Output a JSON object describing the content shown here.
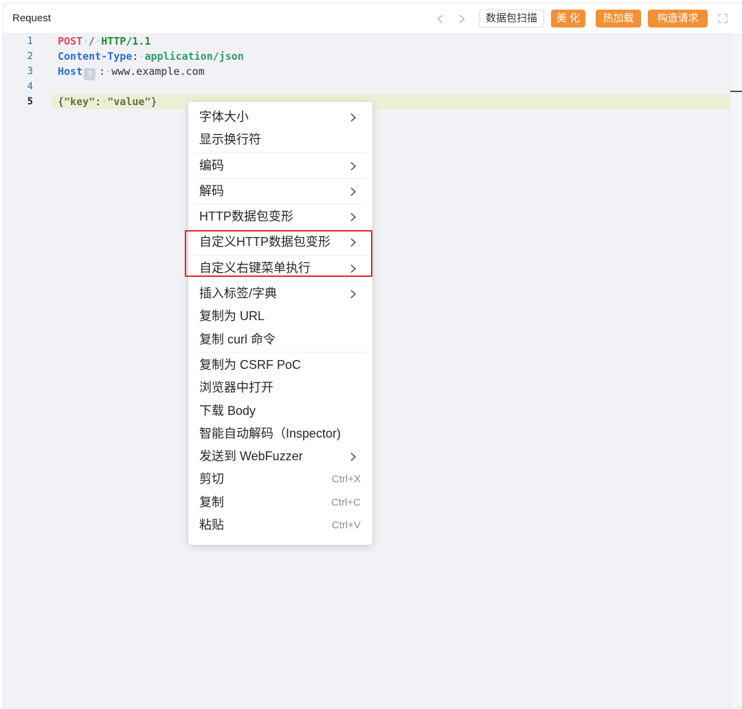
{
  "colors": {
    "accent_orange": "#f39035",
    "highlight_red": "#e3262b",
    "editor_bg": "#f1f2f6",
    "current_line_bg": "#eaf0d6",
    "method": "#dd4760",
    "protocol": "#1d8a38",
    "header_key": "#2a6ed8",
    "header_value": "#2c9a68",
    "json_string": "#6f6b3c"
  },
  "header": {
    "title": "Request",
    "nav": {
      "prev_icon": "chevron-left-icon",
      "next_icon": "chevron-right-icon"
    },
    "buttons": {
      "scan": "数据包扫描",
      "beautify": "美 化",
      "hot_reload": "热加载",
      "build_request": "构造请求"
    },
    "fullscreen_icon": "expand-icon"
  },
  "editor": {
    "active_line": 5,
    "line_numbers": [
      "1",
      "2",
      "3",
      "4",
      "5"
    ],
    "lines": [
      [
        "POST",
        "·",
        "/",
        "·",
        "HTTP/1.1"
      ],
      [
        "Content-Type",
        ":",
        "·",
        "application/json"
      ],
      [
        "Host",
        "?",
        ":",
        "·",
        "www.example.com"
      ],
      [],
      [
        "{",
        "\"key\"",
        ":",
        "·",
        "\"value\"",
        "}"
      ]
    ]
  },
  "context_menu": {
    "submenu_icon": "chevron-right-icon",
    "highlighted_items": [
      5,
      6
    ],
    "items": [
      {
        "label": "字体大小",
        "submenu": true
      },
      {
        "label": "显示换行符",
        "submenu": false,
        "divider_after": true
      },
      {
        "label": "编码",
        "submenu": true,
        "divider_after": true
      },
      {
        "label": "解码",
        "submenu": true,
        "divider_after": true
      },
      {
        "label": "HTTP数据包变形",
        "submenu": true,
        "divider_after": true
      },
      {
        "label": "自定义HTTP数据包变形",
        "submenu": true,
        "divider_after": true
      },
      {
        "label": "自定义右键菜单执行",
        "submenu": true,
        "divider_after": true
      },
      {
        "label": "插入标签/字典",
        "submenu": true
      },
      {
        "label": "复制为 URL",
        "submenu": false
      },
      {
        "label": "复制 curl 命令",
        "submenu": false,
        "divider_after": true
      },
      {
        "label": "复制为 CSRF PoC",
        "submenu": false
      },
      {
        "label": "浏览器中打开",
        "submenu": false
      },
      {
        "label": "下载 Body",
        "submenu": false
      },
      {
        "label": "智能自动解码（Inspector)",
        "submenu": false
      },
      {
        "label": "发送到 WebFuzzer",
        "submenu": true
      },
      {
        "label": "剪切",
        "submenu": false,
        "shortcut": "Ctrl+X"
      },
      {
        "label": "复制",
        "submenu": false,
        "shortcut": "Ctrl+C"
      },
      {
        "label": "粘贴",
        "submenu": false,
        "shortcut": "Ctrl+V"
      }
    ]
  }
}
